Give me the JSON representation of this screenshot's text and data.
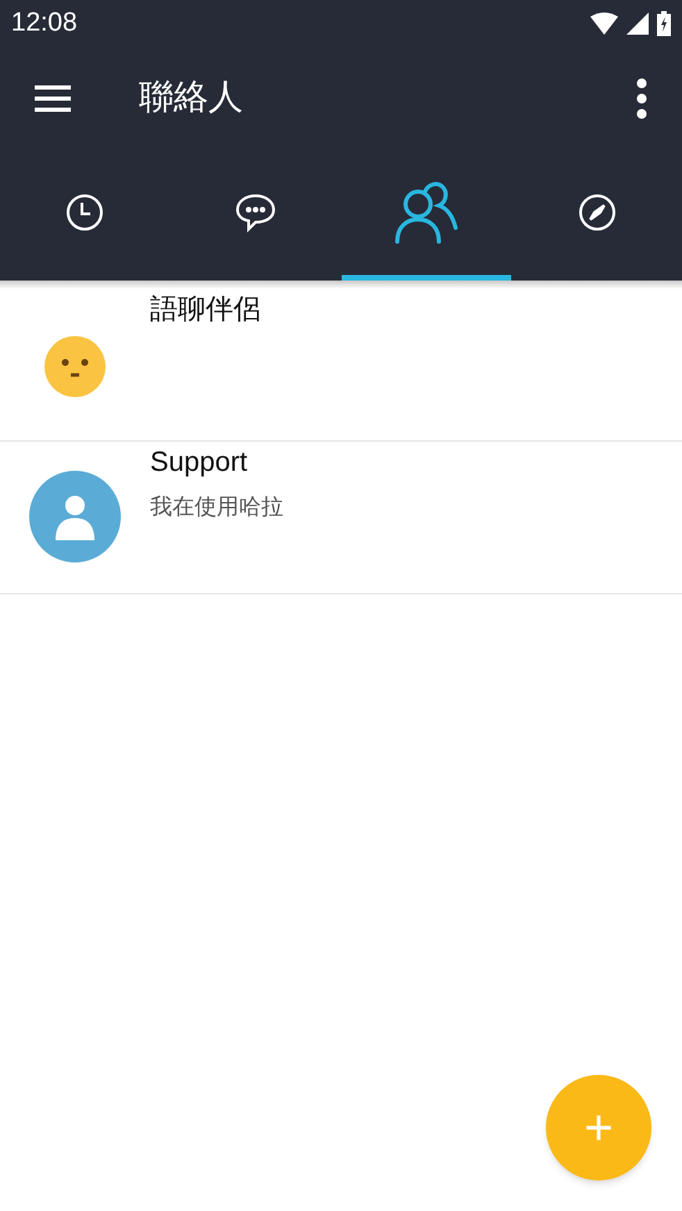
{
  "status_bar": {
    "time": "12:08"
  },
  "app_bar": {
    "title": "聯絡人"
  },
  "tabs": [
    {
      "kind": "clock",
      "selected": false
    },
    {
      "kind": "chat",
      "selected": false
    },
    {
      "kind": "people",
      "selected": true
    },
    {
      "kind": "compass",
      "selected": false
    }
  ],
  "contacts": [
    {
      "kind": "emoji",
      "name": "語聊伴侶"
    },
    {
      "kind": "person",
      "name": "Support",
      "status": "我在使用哈拉"
    }
  ],
  "fab": {
    "label": "+"
  }
}
